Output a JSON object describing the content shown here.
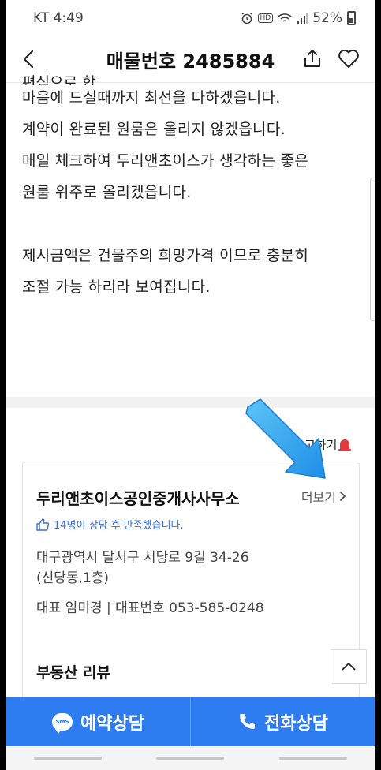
{
  "status_bar": {
    "carrier_time": "KT 4:49",
    "battery": "52%"
  },
  "header": {
    "title": "매물번호 2485884"
  },
  "description": {
    "cut_line": "편심으로 합",
    "lines": [
      "마음에 드실때까지 최선을 다하겠읍니다.",
      "계약이 완료된 원룸은 올리지 않겠읍니다.",
      "매일 체크하여 두리앤초이스가 생각하는 좋은",
      "원룸 위주로 올리겠읍니다.",
      "",
      "제시금액은 건물주의 희망가격 이므로 충분히",
      "조절 가능 하리라 보여집니다."
    ]
  },
  "report": {
    "label": "고하기"
  },
  "agent": {
    "name": "두리앤초이스공인중개사사무소",
    "more": "더보기",
    "satisfaction": "14명이 상담 후 만족했습니다.",
    "address_line1": "대구광역시 달서구 서당로 9길 34-26",
    "address_line2": "(신당동,1층)",
    "contact": "대표 임미경 | 대표번호 053-585-0248"
  },
  "review": {
    "title": "부동산 리뷰"
  },
  "bottom_bar": {
    "reserve_label": "예약상담",
    "call_label": "전화상담",
    "sms_badge": "SMS"
  },
  "colors": {
    "accent": "#2d7cf0",
    "arrow": "#35a9f0",
    "siren": "#e23b3b",
    "satisfaction_text": "#3b6fd8"
  },
  "icons": [
    "back-arrow-icon",
    "share-icon",
    "heart-icon",
    "alarm-icon",
    "wifi-icon",
    "signal-icon",
    "battery-icon",
    "siren-icon",
    "thumbs-up-icon",
    "chevron-right-icon",
    "chevron-up-icon",
    "sms-icon",
    "phone-icon",
    "blue-arrow-annotation"
  ]
}
